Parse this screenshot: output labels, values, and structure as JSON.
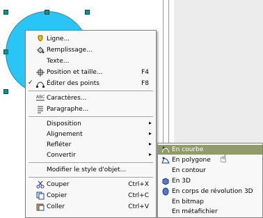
{
  "menu": {
    "items": [
      {
        "label": "Ligne...",
        "icon": "line-icon"
      },
      {
        "label": "Remplissage...",
        "icon": "fill-icon"
      },
      {
        "label": "Texte...",
        "icon": ""
      },
      {
        "label": "Position et taille...",
        "icon": "position-icon",
        "shortcut": "F4"
      },
      {
        "label": "Éditer des points",
        "icon": "points-icon",
        "shortcut": "F8",
        "checked": true
      },
      {
        "label": "Caractères...",
        "icon": "characters-icon"
      },
      {
        "label": "Paragraphe...",
        "icon": "paragraph-icon"
      },
      {
        "label": "Disposition",
        "submenu": true
      },
      {
        "label": "Alignement",
        "submenu": true
      },
      {
        "label": "Refléter",
        "submenu": true
      },
      {
        "label": "Convertir",
        "submenu": true
      },
      {
        "label": "Modifier le style d'objet..."
      },
      {
        "label": "Couper",
        "icon": "scissors-icon",
        "shortcut": "Ctrl+X"
      },
      {
        "label": "Copier",
        "icon": "copy-icon",
        "shortcut": "Ctrl+C"
      },
      {
        "label": "Coller",
        "icon": "paste-icon",
        "shortcut": "Ctrl+V"
      }
    ]
  },
  "submenu": {
    "items": [
      {
        "label": "En courbe",
        "icon": "curve-icon",
        "highlighted": true
      },
      {
        "label": "En polygone",
        "icon": "polygon-icon"
      },
      {
        "label": "En contour",
        "icon": ""
      },
      {
        "label": "En 3D",
        "icon": "3d-icon"
      },
      {
        "label": "En corps de révolution 3D",
        "icon": "rotation-body-icon"
      },
      {
        "label": "En bitmap",
        "icon": ""
      },
      {
        "label": "En métafichier",
        "icon": ""
      }
    ]
  },
  "colors": {
    "shape_fill": "#29c5f6",
    "highlight": "#8f9c6a",
    "handle": "#009999"
  }
}
